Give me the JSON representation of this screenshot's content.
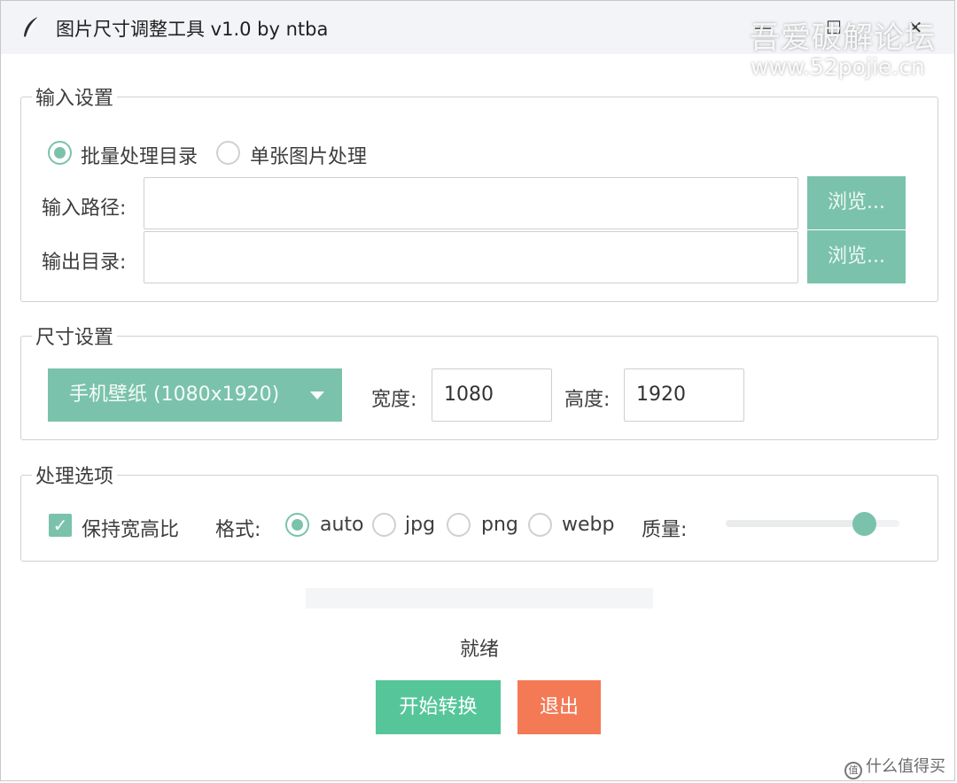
{
  "window": {
    "title": "图片尺寸调整工具 v1.0 by ntba",
    "min_glyph": "—",
    "max_glyph": "☐",
    "close_glyph": "✕",
    "icon": "feather-icon"
  },
  "watermark": {
    "line1": "吾爱破解论坛",
    "line2": "www.52pojie.cn"
  },
  "input_group": {
    "legend": "输入设置",
    "mode_options": [
      {
        "label": "批量处理目录",
        "selected": true
      },
      {
        "label": "单张图片处理",
        "selected": false
      }
    ],
    "input_path_label": "输入路径:",
    "input_path_value": "",
    "output_dir_label": "输出目录:",
    "output_dir_value": "",
    "browse_label_1": "浏览...",
    "browse_label_2": "浏览..."
  },
  "size_group": {
    "legend": "尺寸设置",
    "preset_selected": "手机壁纸 (1080x1920)",
    "width_label": "宽度:",
    "width_value": "1080",
    "height_label": "高度:",
    "height_value": "1920"
  },
  "options_group": {
    "legend": "处理选项",
    "keep_ratio_label": "保持宽高比",
    "keep_ratio_checked": true,
    "checkmark": "✓",
    "format_label": "格式:",
    "formats": [
      {
        "label": "auto",
        "selected": true
      },
      {
        "label": "jpg",
        "selected": false
      },
      {
        "label": "png",
        "selected": false
      },
      {
        "label": "webp",
        "selected": false
      }
    ],
    "quality_label": "质量:",
    "quality_fraction": 0.8
  },
  "progress": {
    "fraction": 0
  },
  "status_text": "就绪",
  "actions": {
    "start_label": "开始转换",
    "exit_label": "退出"
  },
  "source_watermark": {
    "badge": "值",
    "text": "什么值得买"
  },
  "colors": {
    "accent": "#7ac2ab",
    "start": "#56c69a",
    "exit": "#f47a56"
  }
}
